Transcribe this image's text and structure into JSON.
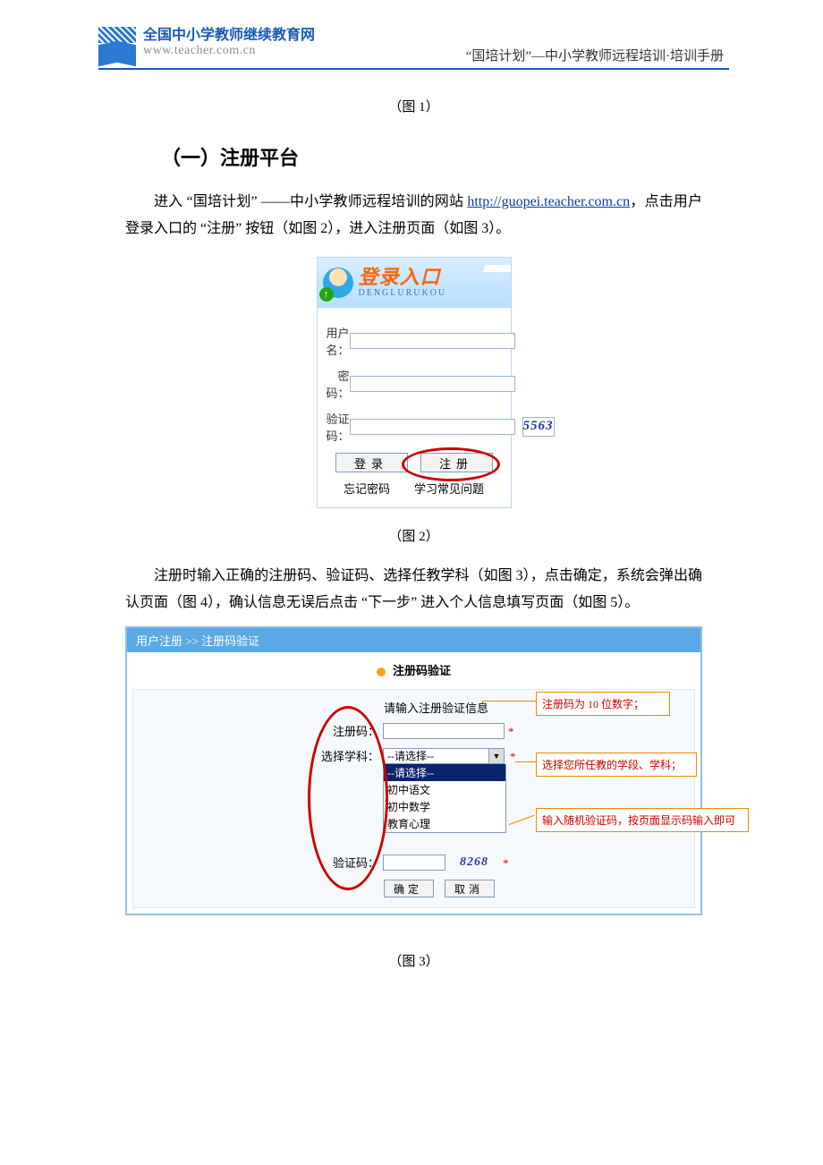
{
  "header": {
    "site_name": "全国中小学教师继续教育网",
    "site_url": "www.teacher.com.cn",
    "doc_title": "“国培计划”—中小学教师远程培训·培训手册"
  },
  "captions": {
    "fig1": "（图 1）",
    "fig2": "（图 2）",
    "fig3": "（图 3）"
  },
  "section": {
    "heading": "（一）注册平台"
  },
  "para1": {
    "prefix": "进入 “国培计划” ——中小学教师远程培训的网站 ",
    "link_text": "http://guopei.teacher.com.cn",
    "suffix": "，点击用户登录入口的 “注册” 按钮（如图 2），进入注册页面（如图 3）。"
  },
  "login_panel": {
    "title_cn": "登录入口",
    "title_pinyin": "DENGLURUKOU",
    "label_user": "用户名：",
    "label_pass": "密码：",
    "label_captcha": "验证码：",
    "captcha_value": "5563",
    "btn_login": "登录",
    "btn_register": "注册",
    "forgot_pw": "忘记密码",
    "faq": "学习常见问题"
  },
  "para2": "注册时输入正确的注册码、验证码、选择任教学科（如图 3），点击确定，系统会弹出确认页面（图 4），确认信息无误后点击 “下一步” 进入个人信息填写页面（如图 5）。",
  "reg_panel": {
    "breadcrumb": "用户注册 >> 注册码验证",
    "step_title": "注册码验证",
    "prompt": "请输入注册验证信息",
    "label_regcode": "注册码：",
    "label_subject": "选择学科：",
    "label_captcha": "验证码：",
    "select_placeholder": "--请选择--",
    "options": [
      "--请选择--",
      "初中语文",
      "初中数学",
      "教育心理"
    ],
    "captcha_value": "8268",
    "btn_ok": "确定",
    "btn_cancel": "取消",
    "annotations": {
      "a1": "注册码为 10 位数字；",
      "a2": "选择您所任教的学段、学科；",
      "a3": "输入随机验证码，按页面显示码输入即可"
    }
  }
}
